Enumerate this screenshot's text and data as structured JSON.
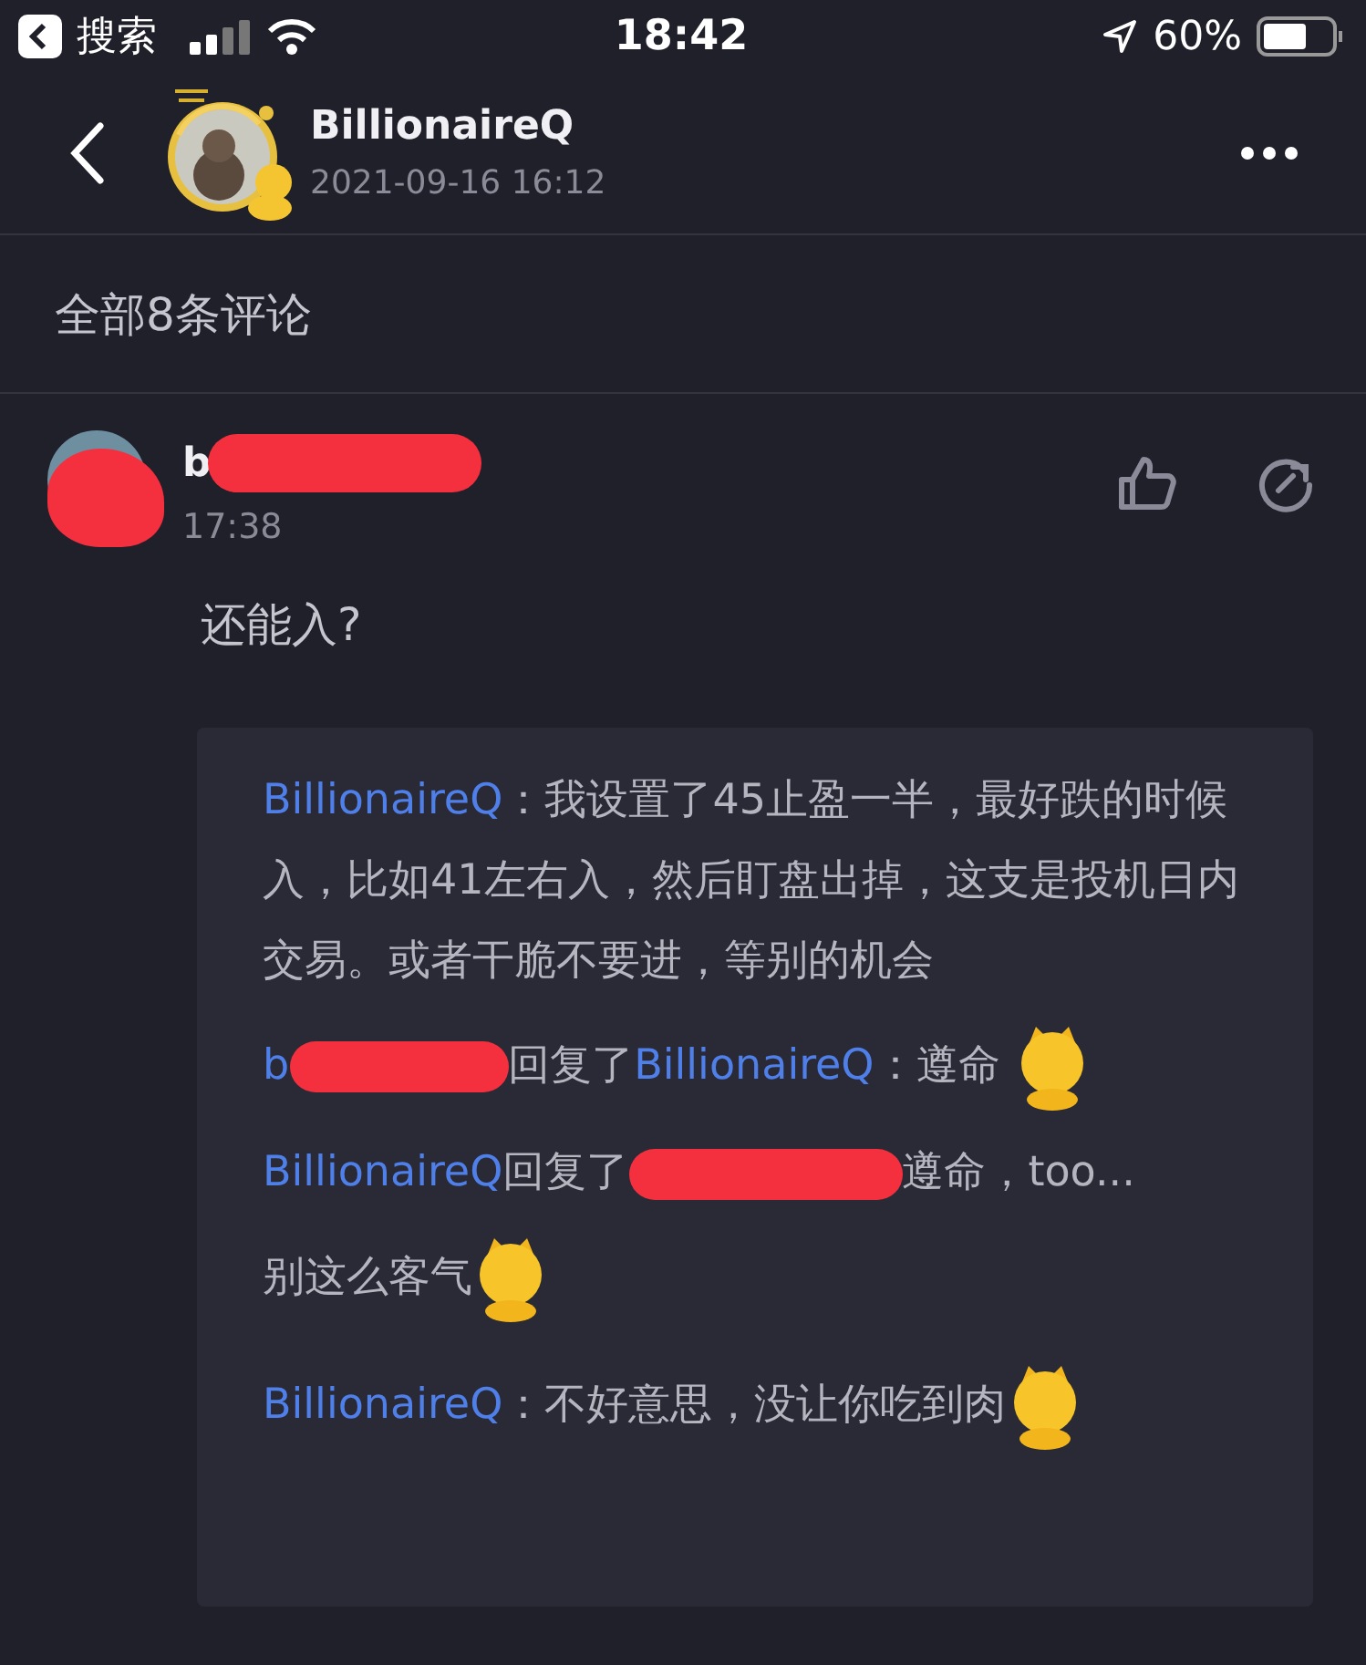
{
  "status_bar": {
    "back_app": "搜索",
    "time": "18:42",
    "battery": "60%"
  },
  "post_header": {
    "author": "BillionaireQ",
    "date": "2021-09-16 16:12"
  },
  "comments_heading": "全部8条评论",
  "comment": {
    "author_visible": "b",
    "author_redacted": true,
    "time": "17:38",
    "text": "还能入?",
    "replies": [
      {
        "segments": [
          {
            "kind": "user",
            "text": "BillionaireQ"
          },
          {
            "kind": "text",
            "text": "：我设置了45止盈一半，最好跌的时候入，比如41左右入，然后盯盘出掉，这支是投机日内交易。或者干脆不要进，等别的机会"
          }
        ]
      },
      {
        "segments": [
          {
            "kind": "user",
            "text": "b"
          },
          {
            "kind": "redacted"
          },
          {
            "kind": "text",
            "text": "回复了"
          },
          {
            "kind": "user",
            "text": "BillionaireQ"
          },
          {
            "kind": "text",
            "text": "：遵命 "
          },
          {
            "kind": "emoji"
          }
        ]
      },
      {
        "segments": [
          {
            "kind": "user",
            "text": "BillionaireQ"
          },
          {
            "kind": "text",
            "text": "回复了"
          },
          {
            "kind": "redacted"
          },
          {
            "kind": "text",
            "text": "遵命，too..."
          }
        ]
      },
      {
        "segments": [
          {
            "kind": "text",
            "text": "别这么客气"
          },
          {
            "kind": "emoji"
          }
        ]
      },
      {
        "segments": [
          {
            "kind": "user",
            "text": "BillionaireQ"
          },
          {
            "kind": "text",
            "text": "：不好意思，没让你吃到肉"
          },
          {
            "kind": "emoji"
          }
        ]
      }
    ]
  }
}
